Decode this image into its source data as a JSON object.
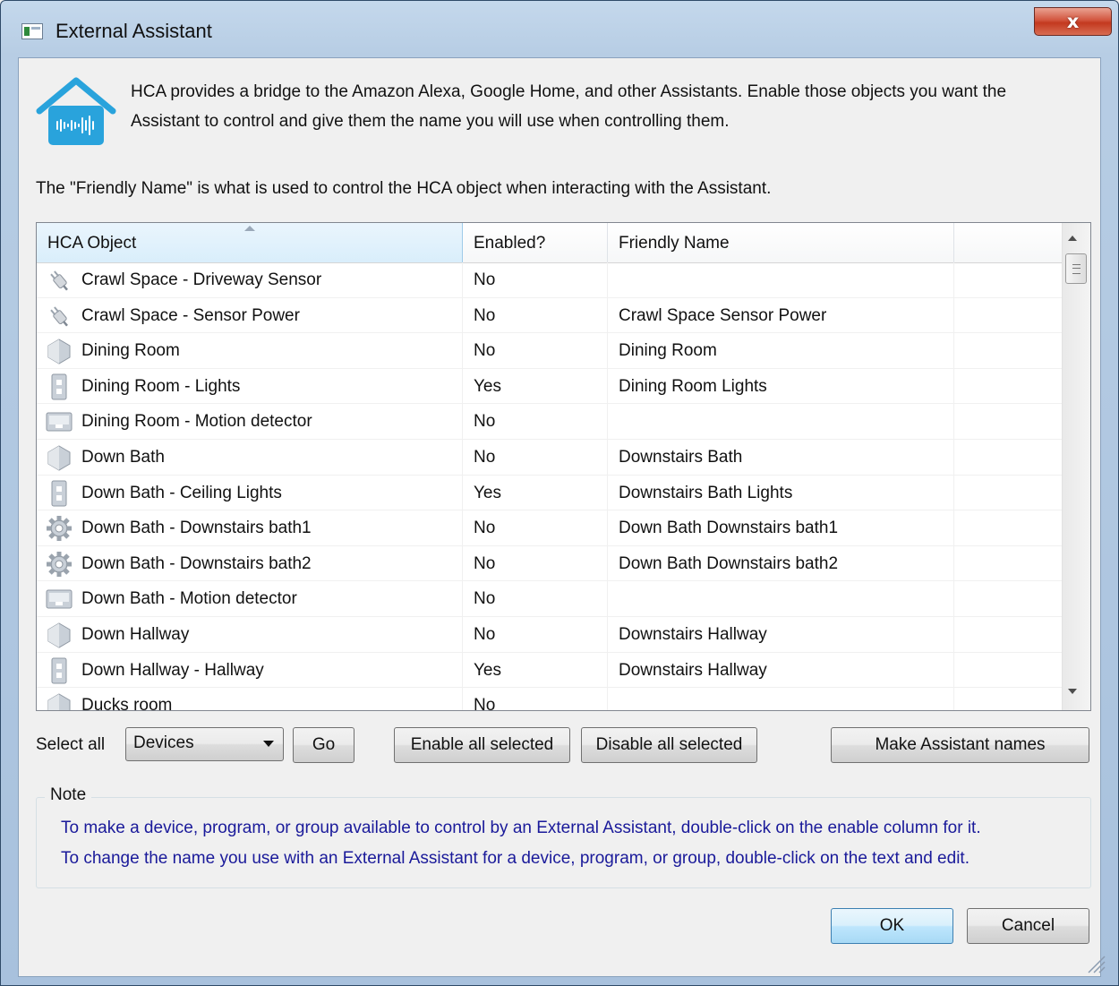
{
  "window": {
    "title": "External Assistant",
    "close_glyph": "x"
  },
  "intro": {
    "text": "HCA provides a bridge to the Amazon Alexa, Google Home, and other Assistants. Enable those objects you want the Assistant to control and give them the name you will use when controlling them.",
    "icon": "home-assistant-icon"
  },
  "friendly_note": "The \"Friendly Name\" is what is used to control the HCA object when interacting with the Assistant.",
  "table": {
    "columns": [
      "HCA Object",
      "Enabled?",
      "Friendly Name",
      ""
    ],
    "rows": [
      {
        "icon": "plug-icon",
        "object": "Crawl Space - Driveway Sensor",
        "enabled": "No",
        "friendly": ""
      },
      {
        "icon": "plug-icon",
        "object": "Crawl Space - Sensor Power",
        "enabled": "No",
        "friendly": "Crawl Space Sensor Power"
      },
      {
        "icon": "room-icon",
        "object": "Dining Room",
        "enabled": "No",
        "friendly": "Dining Room"
      },
      {
        "icon": "switch-icon",
        "object": "Dining Room - Lights",
        "enabled": "Yes",
        "friendly": "Dining Room Lights"
      },
      {
        "icon": "motion-detector-icon",
        "object": "Dining Room - Motion detector",
        "enabled": "No",
        "friendly": ""
      },
      {
        "icon": "room-icon",
        "object": "Down Bath",
        "enabled": "No",
        "friendly": "Downstairs Bath"
      },
      {
        "icon": "switch-icon",
        "object": "Down Bath - Ceiling Lights",
        "enabled": "Yes",
        "friendly": "Downstairs Bath Lights"
      },
      {
        "icon": "gear-icon",
        "object": "Down Bath - Downstairs bath1",
        "enabled": "No",
        "friendly": "Down Bath Downstairs bath1"
      },
      {
        "icon": "gear-icon",
        "object": "Down Bath - Downstairs bath2",
        "enabled": "No",
        "friendly": "Down Bath Downstairs bath2"
      },
      {
        "icon": "motion-detector-icon",
        "object": "Down Bath - Motion detector",
        "enabled": "No",
        "friendly": ""
      },
      {
        "icon": "room-icon",
        "object": "Down Hallway",
        "enabled": "No",
        "friendly": "Downstairs Hallway"
      },
      {
        "icon": "switch-icon",
        "object": "Down Hallway - Hallway",
        "enabled": "Yes",
        "friendly": "Downstairs Hallway"
      },
      {
        "icon": "room-icon",
        "object": "Ducks room",
        "enabled": "No",
        "friendly": ""
      }
    ]
  },
  "controls": {
    "select_all_label": "Select all",
    "select_value": "Devices",
    "go_label": "Go",
    "enable_label": "Enable all selected",
    "disable_label": "Disable all selected",
    "make_names_label": "Make Assistant names"
  },
  "note": {
    "title": "Note",
    "line1": "To make a device, program, or group available to control by an External Assistant, double-click on the enable column for it.",
    "line2": "To change the name you use with an External Assistant for a device, program, or group, double-click on the text and edit."
  },
  "footer": {
    "ok_label": "OK",
    "cancel_label": "Cancel"
  },
  "colors": {
    "note_text": "#1a1a9a",
    "icon_blue": "#29a3dc",
    "close_red": "#c3391f"
  }
}
